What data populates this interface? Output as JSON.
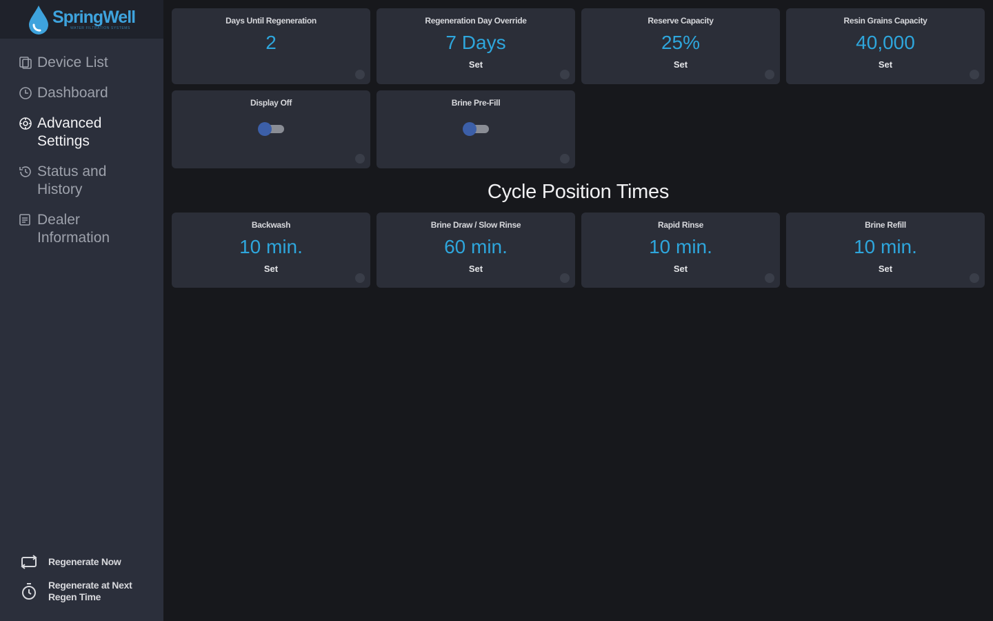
{
  "brand": {
    "name": "SpringWell",
    "tagline": "WATER FILTRATION SYSTEMS",
    "accent": "#3ea3dd"
  },
  "sidebar": {
    "items": [
      {
        "label": "Device List",
        "icon": "device-list-icon"
      },
      {
        "label": "Dashboard",
        "icon": "clock-icon"
      },
      {
        "label": "Advanced Settings",
        "icon": "settings-icon",
        "active": true
      },
      {
        "label": "Status and History",
        "icon": "history-icon"
      },
      {
        "label": "Dealer Information",
        "icon": "dealer-info-icon"
      }
    ],
    "actions": [
      {
        "label": "Regenerate Now",
        "icon": "regenerate-icon"
      },
      {
        "label": "Regenerate at Next Regen Time",
        "icon": "timer-icon"
      }
    ]
  },
  "settings": {
    "days_until_regen": {
      "title": "Days Until Regeneration",
      "value": "2"
    },
    "regen_day_override": {
      "title": "Regeneration Day Override",
      "value": "7 Days",
      "set": "Set"
    },
    "reserve_capacity": {
      "title": "Reserve Capacity",
      "value": "25%",
      "set": "Set"
    },
    "resin_grains": {
      "title": "Resin Grains Capacity",
      "value": "40,000",
      "set": "Set"
    },
    "display_off": {
      "title": "Display Off",
      "enabled": false
    },
    "brine_prefill": {
      "title": "Brine Pre-Fill",
      "enabled": false
    }
  },
  "cycle": {
    "title": "Cycle Position Times",
    "backwash": {
      "title": "Backwash",
      "value": "10 min.",
      "set": "Set"
    },
    "brine_draw": {
      "title": "Brine Draw / Slow Rinse",
      "value": "60 min.",
      "set": "Set"
    },
    "rapid_rinse": {
      "title": "Rapid Rinse",
      "value": "10 min.",
      "set": "Set"
    },
    "brine_refill": {
      "title": "Brine Refill",
      "value": "10 min.",
      "set": "Set"
    }
  },
  "colors": {
    "value": "#2ea6dc",
    "card": "#2b2e38",
    "background": "#17181c",
    "sidebar": "#2b2f3b"
  }
}
